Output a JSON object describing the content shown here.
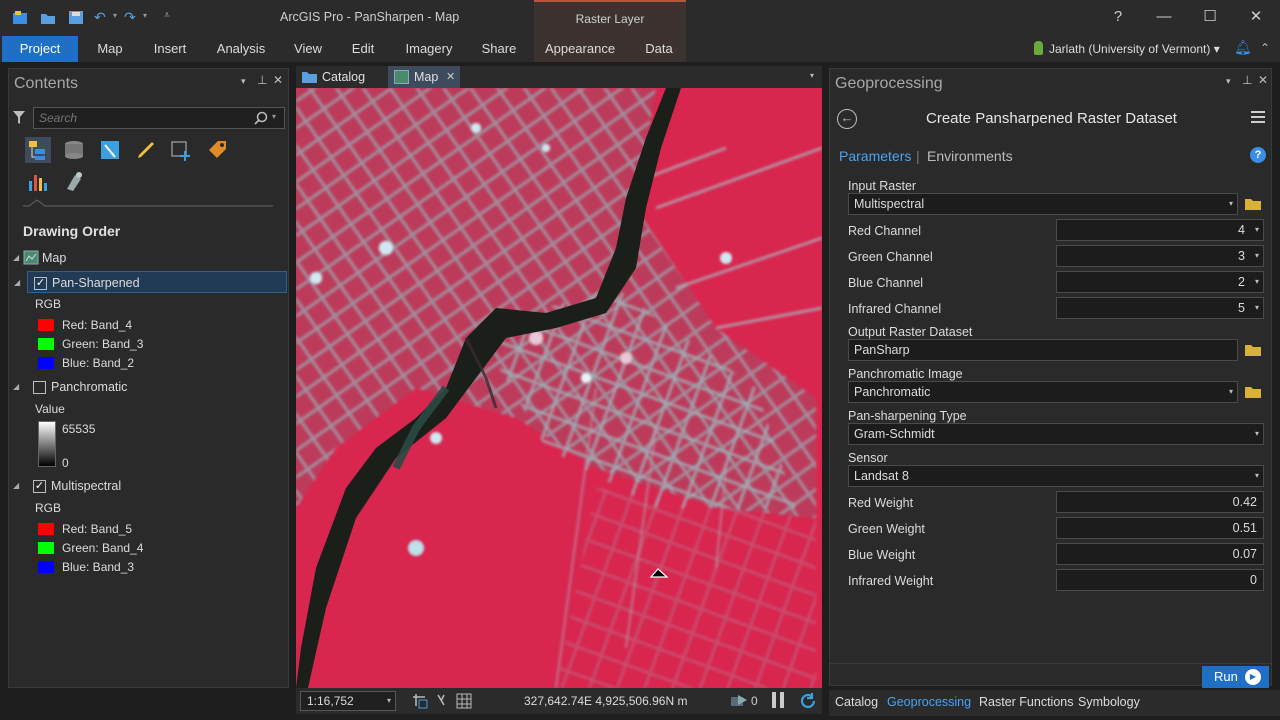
{
  "app": {
    "title": "ArcGIS Pro - PanSharpen - Map",
    "context_tab_group": "Raster Layer",
    "window_controls": {
      "help": "?",
      "minimize": "—",
      "maximize": "☐",
      "close": "✕"
    }
  },
  "ribbon": {
    "tabs": [
      "Project",
      "Map",
      "Insert",
      "Analysis",
      "View",
      "Edit",
      "Imagery",
      "Share",
      "Appearance",
      "Data"
    ],
    "user": "Jarlath (University of Vermont) ▾"
  },
  "contents": {
    "title": "Contents",
    "search_placeholder": "Search",
    "section": "Drawing Order",
    "map_label": "Map",
    "layers": [
      {
        "name": "Pan-Sharpened",
        "checked": true,
        "renderer": "RGB",
        "bands": [
          {
            "label": "Red:  Band_4",
            "color": "#ff0000"
          },
          {
            "label": "Green: Band_3",
            "color": "#00ff00"
          },
          {
            "label": "Blue:  Band_2",
            "color": "#0000ff"
          }
        ]
      },
      {
        "name": "Panchromatic",
        "checked": false,
        "renderer": "Value",
        "max": "65535",
        "min": "0"
      },
      {
        "name": "Multispectral",
        "checked": true,
        "renderer": "RGB",
        "bands": [
          {
            "label": "Red:  Band_5",
            "color": "#ff0000"
          },
          {
            "label": "Green: Band_4",
            "color": "#00ff00"
          },
          {
            "label": "Blue:  Band_3",
            "color": "#0000ff"
          }
        ]
      }
    ],
    "check_mark": "✓"
  },
  "view": {
    "tabs": [
      "Catalog",
      "Map"
    ],
    "scale": "1:16,752",
    "coordinates": "327,642.74E 4,925,506.96N m",
    "selected_count": "0"
  },
  "geoprocessing": {
    "title": "Geoprocessing",
    "tool_title": "Create Pansharpened Raster Dataset",
    "tab_parameters": "Parameters",
    "tab_separator": "|",
    "tab_environments": "Environments",
    "help": "?",
    "params": {
      "input_raster": {
        "label": "Input Raster",
        "value": "Multispectral"
      },
      "red_channel": {
        "label": "Red Channel",
        "value": "4"
      },
      "green_channel": {
        "label": "Green Channel",
        "value": "3"
      },
      "blue_channel": {
        "label": "Blue Channel",
        "value": "2"
      },
      "infrared_channel": {
        "label": "Infrared Channel",
        "value": "5"
      },
      "output_raster": {
        "label": "Output Raster Dataset",
        "value": "PanSharp"
      },
      "pan_image": {
        "label": "Panchromatic Image",
        "value": "Panchromatic"
      },
      "pan_type": {
        "label": "Pan-sharpening Type",
        "value": "Gram-Schmidt"
      },
      "sensor": {
        "label": "Sensor",
        "value": "Landsat 8"
      },
      "red_weight": {
        "label": "Red Weight",
        "value": "0.42"
      },
      "green_weight": {
        "label": "Green Weight",
        "value": "0.51"
      },
      "blue_weight": {
        "label": "Blue Weight",
        "value": "0.07"
      },
      "infrared_weight": {
        "label": "Infrared Weight",
        "value": "0"
      }
    },
    "run": "Run"
  },
  "bottom_tabs": [
    "Catalog",
    "Geoprocessing",
    "Raster Functions",
    "Symbology"
  ],
  "colors": {
    "accent": "#1f6fc5",
    "link": "#4aa3f0",
    "raster_tab": "#c0533d",
    "map_red": "#d8264f"
  }
}
